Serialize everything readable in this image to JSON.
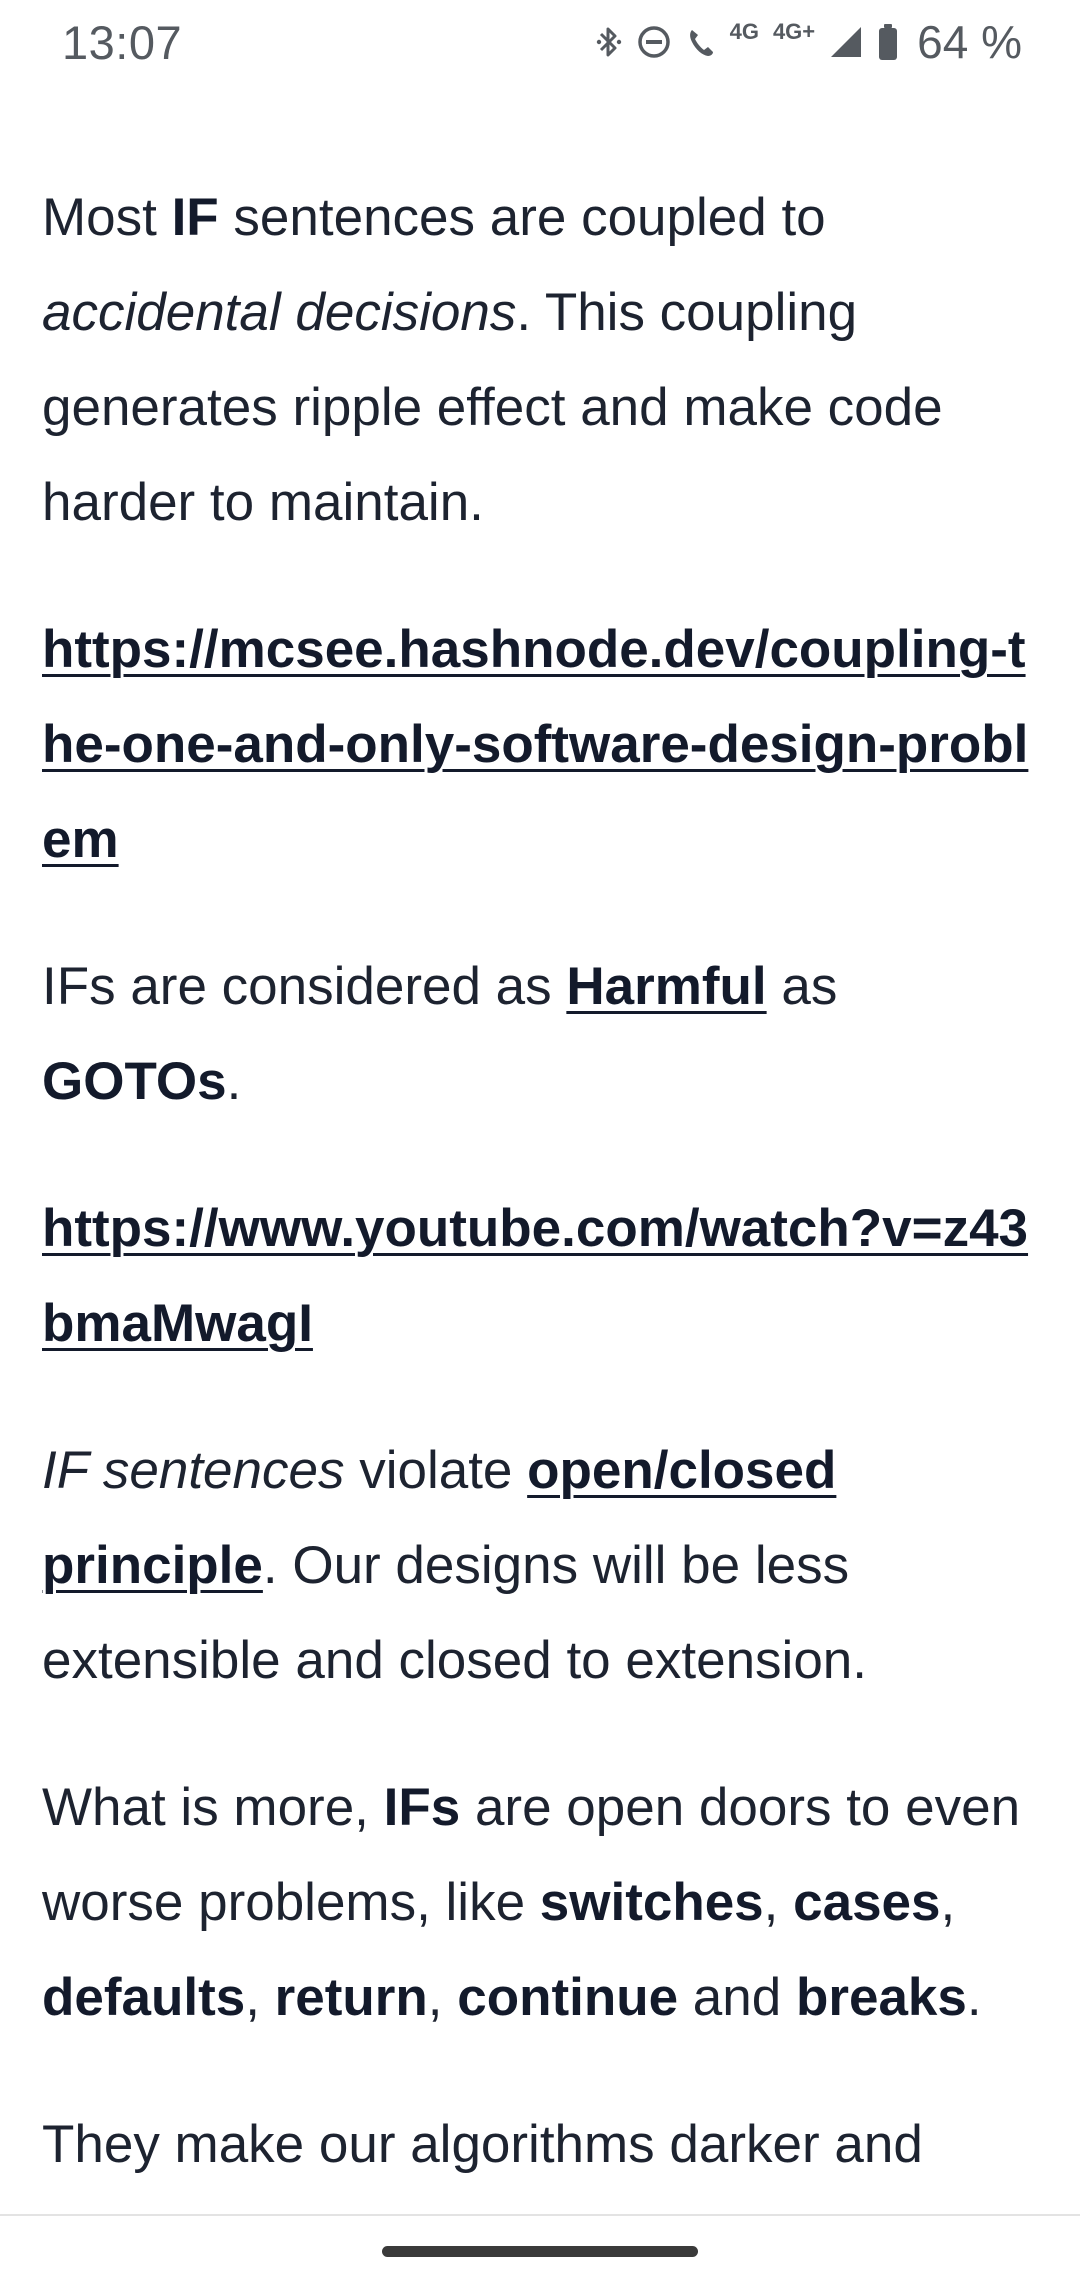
{
  "status_bar": {
    "time": "13:07",
    "network_small": "4G",
    "network_type": "4G+",
    "battery_percent": "64 %",
    "icons": [
      "bluetooth-icon",
      "do-not-disturb-icon",
      "volte-call-icon",
      "signal-icon",
      "battery-icon"
    ]
  },
  "article": {
    "p1": {
      "t1": "Most ",
      "b1": "IF",
      "t2": " sentences are coupled to ",
      "i1": "accidental decisions",
      "t3": ". This coupling generates ripple effect and make code harder to maintain."
    },
    "link1": "https://mcsee.hashnode.dev/coupling-the-one-and-only-software-design-problem",
    "p2": {
      "t1": "IFs are considered as ",
      "a1": "Harmful",
      "t2": " as ",
      "b1": "GOTOs",
      "t3": "."
    },
    "link2": "https://www.youtube.com/watch?v=z43bmaMwagI",
    "p3": {
      "i1": "IF sentences",
      "t1": " violate ",
      "a1": "open/closed principle",
      "t2": ". Our designs will be less extensible and closed to extension."
    },
    "p4": {
      "t1": "What is more, ",
      "b1": "IFs",
      "t2": " are open doors to even worse problems, like ",
      "b2": "switches",
      "t3": ", ",
      "b3": "cases",
      "t4": ", ",
      "b4": "defaults",
      "t5": ", ",
      "b5": "return",
      "t6": ", ",
      "b6": "continue",
      "t7": " and ",
      "b7": "breaks",
      "t8": "."
    },
    "p5": {
      "t1": "They make our algorithms darker and"
    }
  },
  "colors": {
    "text": "#1d2330",
    "emphasis": "#131a2b",
    "status": "#555a60",
    "background": "#ffffff"
  }
}
